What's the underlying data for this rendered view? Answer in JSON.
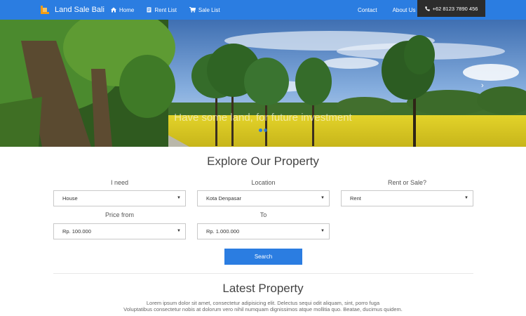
{
  "nav": {
    "brand": "Land Sale Bali",
    "items": [
      {
        "label": "Home",
        "icon": "home-icon"
      },
      {
        "label": "Rent List",
        "icon": "document-icon"
      },
      {
        "label": "Sale List",
        "icon": "cart-icon"
      }
    ],
    "right_items": [
      {
        "label": "Contact"
      },
      {
        "label": "About Us"
      }
    ],
    "phone": "+62 8123 7890 456"
  },
  "hero": {
    "caption": "Have some land, for future investment",
    "next_arrow": "›"
  },
  "explore": {
    "title": "Explore Our Property",
    "fields": [
      {
        "label": "I need",
        "value": "House"
      },
      {
        "label": "Location",
        "value": "Kota Denpasar"
      },
      {
        "label": "Rent or Sale?",
        "value": "Rent"
      },
      {
        "label": "Price from",
        "value": "Rp. 100.000"
      },
      {
        "label": "To",
        "value": "Rp. 1.000.000"
      }
    ],
    "search_label": "Search"
  },
  "latest": {
    "title": "Latest Property",
    "text_line1": "Lorem ipsum dolor sit amet, consectetur adipisicing elit. Delectus sequi odit aliquam, sint, porro fuga",
    "text_line2": "Voluptatibus consectetur nobis at dolorum vero nihil numquam dignissimos atque mollitia quo. Beatae, ducimus quidem."
  },
  "colors": {
    "primary": "#2b7de1",
    "phone_bg": "#2c2c2c",
    "logo_orange": "#f39c12"
  }
}
